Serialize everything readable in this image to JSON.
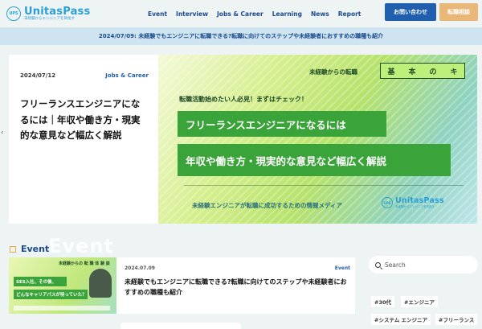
{
  "header": {
    "logo_mark": "UPS",
    "logo_name": "UnitasPass",
    "logo_sub": "未経験からエンジニアを目指す",
    "nav": [
      "Event",
      "Interview",
      "Jobs & Career",
      "Learning",
      "News",
      "Report"
    ],
    "contact_button": "お問い合わせ",
    "consult_button": "転職相談"
  },
  "announcement": "2024/07/09: 未経験でもエンジニアに転職できる?転職に向けてのステップや未経験者におすすめの職種も紹介",
  "hero": {
    "date": "2024/07/12",
    "category": "Jobs & Career",
    "title": "フリーランスエンジニアになるには｜年収や働き方・現実的な意見など幅広く解説",
    "image": {
      "badge_line": "未経験からの転職",
      "badge_chars": [
        "基",
        "本",
        "の",
        "キ"
      ],
      "subtitle": "転職活動始めたい人必見！まずはチェック！",
      "headline1": "フリーランスエンジニアになるには",
      "headline2": "年収や働き方・現実的な意見など幅広く解説",
      "footer": "未経験エンジニアが転職に成功するための情報メディア",
      "logo_mark": "UPS",
      "logo_name": "UnitasPass",
      "logo_sub": "未経験からエンジニアを目指す"
    }
  },
  "arrows": {
    "left": "‹",
    "right": "›"
  },
  "event": {
    "section_label": "Event",
    "ghost_text": "Event",
    "card": {
      "date": "2024.07.09",
      "category": "Event",
      "title": "未経験でもエンジニアに転職できる?転職に向けてのステップや未経験者におすすめの職種も紹介",
      "thumb": {
        "top_text": "未経験からの 転 職 体 験 談",
        "line1": "SES入社、その後、",
        "line2": "どんなキャリアパスが待っていた？"
      }
    }
  },
  "sidebar": {
    "search_placeholder": "Search",
    "tags": [
      "#30代",
      "#エンジニア",
      "#システム エンジニア",
      "#フリーランス"
    ]
  }
}
